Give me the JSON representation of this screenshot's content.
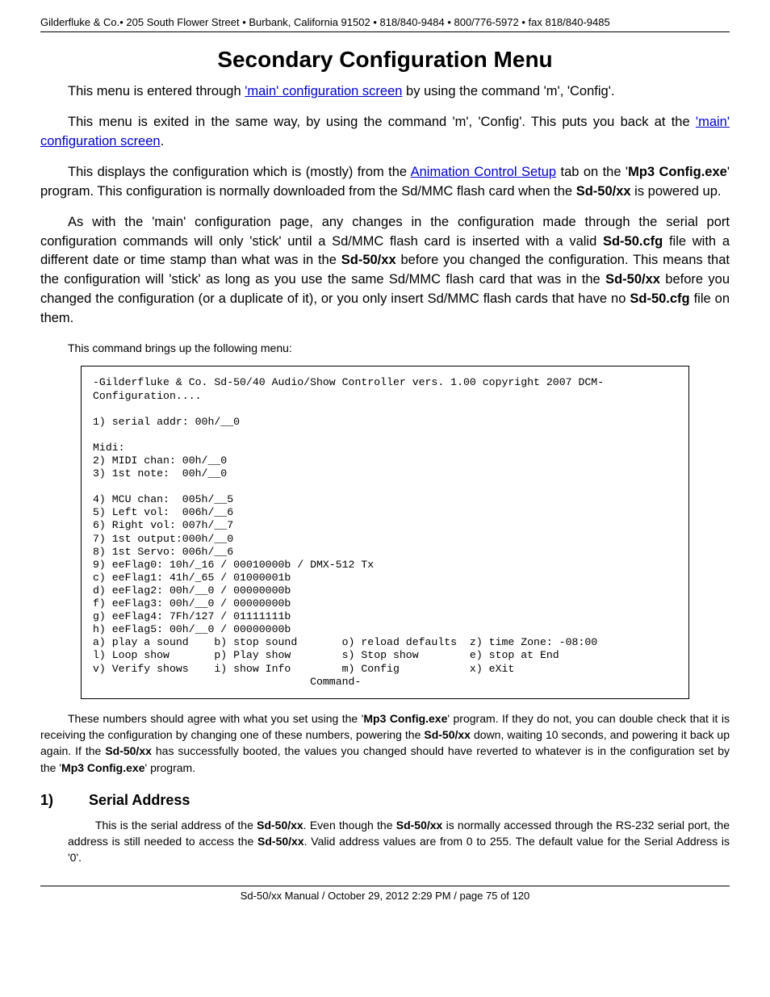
{
  "header": "Gilderfluke & Co.• 205 South Flower Street • Burbank, California 91502 • 818/840-9484 • 800/776-5972 • fax 818/840-9485",
  "title": "Secondary Configuration Menu",
  "p1_a": "This menu is entered through ",
  "p1_link": "'main' configuration screen",
  "p1_b": " by using the command 'm', 'Config'.",
  "p2_a": "This menu is exited in the same way, by using the command 'm', 'Config'. This puts you back at the ",
  "p2_link": "'main' configuration screen",
  "p2_b": ".",
  "p3_a": "This displays the configuration which is (mostly) from the ",
  "p3_link": "Animation Control Setup",
  "p3_b": " tab on the '",
  "p3_bold1": "Mp3 Config.exe",
  "p3_c": "' program. This configuration is normally downloaded from the Sd/MMC flash card when the ",
  "p3_bold2": "Sd-50/xx",
  "p3_d": " is powered up.",
  "p4_a": "As with the 'main' configuration page, any changes in the configuration made through the serial port configuration commands will only 'stick' until a Sd/MMC flash card is inserted with a valid ",
  "p4_bold1": "Sd-50.cfg",
  "p4_b": " file with a different date or time stamp than what was in the ",
  "p4_bold2": "Sd-50/xx",
  "p4_c": " before you changed the configuration. This means that the configuration will 'stick' as long as you use the same Sd/MMC flash card that was in the ",
  "p4_bold3": "Sd-50/xx",
  "p4_d": " before you changed the configuration (or a duplicate of it), or you only insert Sd/MMC flash cards that have no ",
  "p4_bold4": "Sd-50.cfg",
  "p4_e": " file on them.",
  "p5": "This command brings up the following menu:",
  "mono": "-Gilderfluke & Co. Sd-50/40 Audio/Show Controller vers. 1.00 copyright 2007 DCM-\nConfiguration....\n\n1) serial addr: 00h/__0\n\nMidi:\n2) MIDI chan: 00h/__0\n3) 1st note:  00h/__0\n\n4) MCU chan:  005h/__5\n5) Left vol:  006h/__6\n6) Right vol: 007h/__7\n7) 1st output:000h/__0\n8) 1st Servo: 006h/__6\n9) eeFlag0: 10h/_16 / 00010000b / DMX-512 Tx\nc) eeFlag1: 41h/_65 / 01000001b\nd) eeFlag2: 00h/__0 / 00000000b\nf) eeFlag3: 00h/__0 / 00000000b\ng) eeFlag4: 7Fh/127 / 01111111b\nh) eeFlag5: 00h/__0 / 00000000b\na) play a sound    b) stop sound       o) reload defaults  z) time Zone: -08:00\nl) Loop show       p) Play show        s) Stop show        e) stop at End\nv) Verify shows    i) show Info        m) Config           x) eXit\n                                  Command-",
  "p6_a": "These numbers should agree with what you set using the '",
  "p6_bold1": "Mp3 Config.exe",
  "p6_b": "' program. If they do not, you can double check that it is receiving the configuration by changing one of these numbers, powering the ",
  "p6_bold2": "Sd-50/xx",
  "p6_c": " down, waiting 10 seconds, and powering it back up again. If the ",
  "p6_bold3": "Sd-50/xx",
  "p6_d": " has successfully booted, the values you changed should have reverted to whatever is in the configuration set by the '",
  "p6_bold4": "Mp3 Config.exe",
  "p6_e": "' program.",
  "h2_num": "1)",
  "h2_title": "Serial Address",
  "p7_a": "This is the serial address of the ",
  "p7_bold1": "Sd-50/xx",
  "p7_b": ". Even though the ",
  "p7_bold2": "Sd-50/xx",
  "p7_c": " is normally accessed through the RS-232 serial port, the address is still needed to access the ",
  "p7_bold3": "Sd-50/xx",
  "p7_d": ". Valid address values are from 0 to 255. The default value for the Serial Address is '0'.",
  "footer": "Sd-50/xx Manual / October 29, 2012 2:29 PM / page 75 of 120"
}
